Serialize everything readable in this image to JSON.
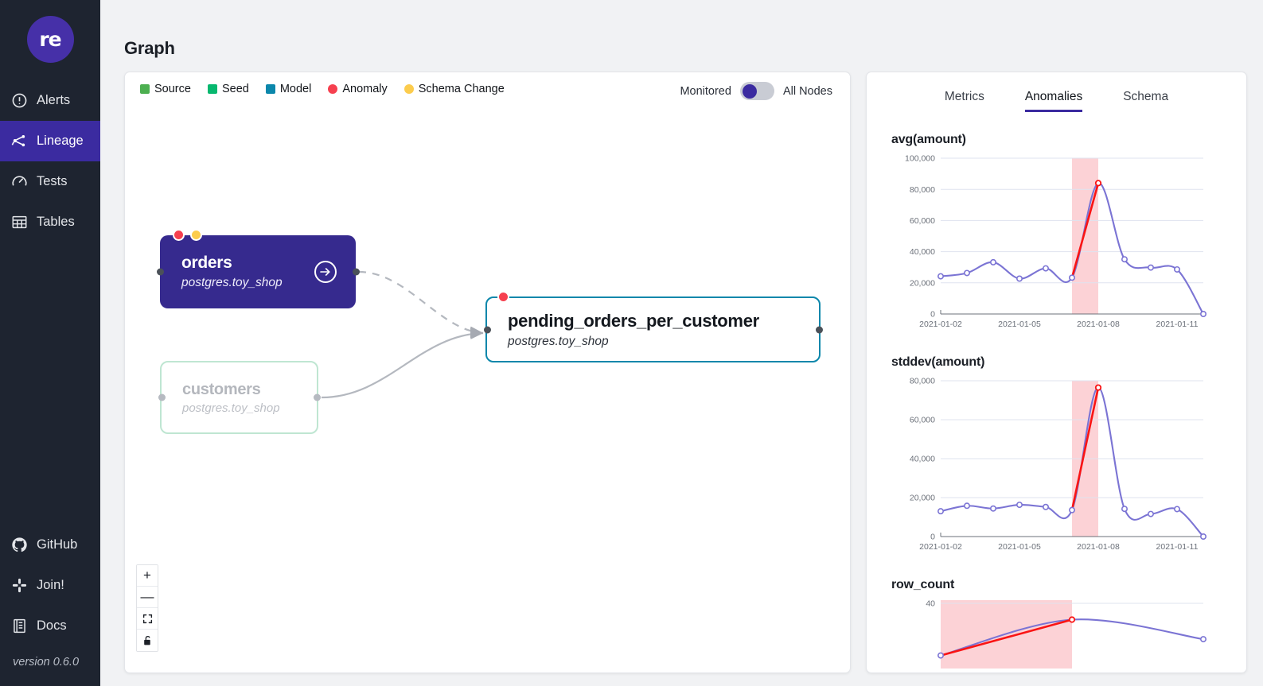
{
  "app": {
    "logo_text": "re",
    "version": "version 0.6.0"
  },
  "sidebar": {
    "items": [
      {
        "label": "Alerts",
        "icon": "alert-circle-icon",
        "active": false
      },
      {
        "label": "Lineage",
        "icon": "lineage-icon",
        "active": true
      },
      {
        "label": "Tests",
        "icon": "gauge-icon",
        "active": false
      },
      {
        "label": "Tables",
        "icon": "table-grid-icon",
        "active": false
      }
    ],
    "bottom_items": [
      {
        "label": "GitHub",
        "icon": "github-icon"
      },
      {
        "label": "Join!",
        "icon": "slack-icon"
      },
      {
        "label": "Docs",
        "icon": "docs-icon"
      }
    ]
  },
  "header": {
    "title": "Graph"
  },
  "graph": {
    "legend": [
      {
        "label": "Source",
        "color": "#4caf50",
        "shape": "square"
      },
      {
        "label": "Seed",
        "color": "#07b86f",
        "shape": "square"
      },
      {
        "label": "Model",
        "color": "#0b87ab",
        "shape": "square"
      },
      {
        "label": "Anomaly",
        "color": "#f6404f",
        "shape": "circle"
      },
      {
        "label": "Schema Change",
        "color": "#fccc4d",
        "shape": "circle"
      }
    ],
    "toggle": {
      "left_label": "Monitored",
      "right_label": "All Nodes",
      "state": "left",
      "knob_color": "#3b2ba0",
      "track_color": "#c9ccd4"
    },
    "nodes": [
      {
        "id": "orders",
        "title": "orders",
        "subtitle": "postgres.toy_shop",
        "style": "selected-source",
        "badges": [
          {
            "name": "anomaly-badge",
            "color": "#f6404f"
          },
          {
            "name": "schema-change-badge",
            "color": "#fccc4d"
          }
        ],
        "action_icon": "arrow-right-circle-icon"
      },
      {
        "id": "customers",
        "title": "customers",
        "subtitle": "postgres.toy_shop",
        "style": "seed-dimmed",
        "badges": []
      },
      {
        "id": "pending_orders_per_customer",
        "title": "pending_orders_per_customer",
        "subtitle": "postgres.toy_shop",
        "style": "model",
        "badges": [
          {
            "name": "anomaly-badge",
            "color": "#f6404f"
          }
        ]
      }
    ],
    "edges": [
      {
        "from": "orders",
        "to": "pending_orders_per_customer",
        "style": "dashed"
      },
      {
        "from": "customers",
        "to": "pending_orders_per_customer",
        "style": "solid"
      }
    ],
    "zoom_controls": [
      {
        "name": "zoom-in-button",
        "glyph": "+"
      },
      {
        "name": "zoom-out-button",
        "glyph": "—"
      },
      {
        "name": "fit-view-button",
        "glyph": "fit-icon"
      },
      {
        "name": "lock-button",
        "glyph": "unlock-icon"
      }
    ]
  },
  "detail_panel": {
    "tabs": [
      {
        "label": "Metrics",
        "active": false
      },
      {
        "label": "Anomalies",
        "active": true
      },
      {
        "label": "Schema",
        "active": false
      }
    ]
  },
  "chart_data": [
    {
      "type": "line",
      "title": "avg(amount)",
      "xlabel": "",
      "ylabel": "",
      "ylim": [
        0,
        100000
      ],
      "yticks": [
        0,
        20000,
        40000,
        60000,
        80000,
        100000
      ],
      "ytick_labels": [
        "0",
        "20,000",
        "40,000",
        "60,000",
        "80,000",
        "100,000"
      ],
      "xticks": [
        "2021-01-02",
        "2021-01-05",
        "2021-01-08",
        "2021-01-11"
      ],
      "grid": true,
      "legend": "none",
      "x": [
        "2021-01-02",
        "2021-01-03",
        "2021-01-04",
        "2021-01-05",
        "2021-01-06",
        "2021-01-07",
        "2021-01-08",
        "2021-01-09",
        "2021-01-10",
        "2021-01-11",
        "2021-01-12"
      ],
      "values": [
        24200,
        26300,
        33200,
        22700,
        29300,
        23300,
        84000,
        35100,
        29800,
        28600,
        0
      ],
      "anomaly_indices": [
        6
      ],
      "anomaly_band": {
        "start": "2021-01-07",
        "end": "2021-01-08",
        "color": "#fcd2d6"
      },
      "series_color": "#7b74d4",
      "anomaly_color": "#fa1414"
    },
    {
      "type": "line",
      "title": "stddev(amount)",
      "xlabel": "",
      "ylabel": "",
      "ylim": [
        0,
        80000
      ],
      "yticks": [
        0,
        20000,
        40000,
        60000,
        80000
      ],
      "ytick_labels": [
        "0",
        "20,000",
        "40,000",
        "60,000",
        "80,000"
      ],
      "xticks": [
        "2021-01-02",
        "2021-01-05",
        "2021-01-08",
        "2021-01-11"
      ],
      "grid": true,
      "legend": "none",
      "x": [
        "2021-01-02",
        "2021-01-03",
        "2021-01-04",
        "2021-01-05",
        "2021-01-06",
        "2021-01-07",
        "2021-01-08",
        "2021-01-09",
        "2021-01-10",
        "2021-01-11",
        "2021-01-12"
      ],
      "values": [
        13000,
        15800,
        14400,
        16300,
        15200,
        13600,
        76500,
        14200,
        11600,
        14100,
        0
      ],
      "anomaly_indices": [
        6
      ],
      "anomaly_band": {
        "start": "2021-01-07",
        "end": "2021-01-08",
        "color": "#fcd2d6"
      },
      "series_color": "#7b74d4",
      "anomaly_color": "#fa1414"
    },
    {
      "type": "line",
      "title": "row_count",
      "xlabel": "",
      "ylabel": "",
      "ylim": [
        0,
        40
      ],
      "yticks": [
        40
      ],
      "ytick_labels": [
        "40"
      ],
      "xticks": [],
      "grid": true,
      "legend": "none",
      "clipped": true,
      "x": [
        "2021-01-07",
        "2021-01-08",
        "2021-01-09"
      ],
      "values": [
        8,
        30,
        18
      ],
      "anomaly_indices": [
        1
      ],
      "anomaly_band": {
        "start": "2021-01-07",
        "end": "2021-01-08",
        "color": "#fcd2d6"
      },
      "series_color": "#7b74d4",
      "anomaly_color": "#fa1414"
    }
  ]
}
